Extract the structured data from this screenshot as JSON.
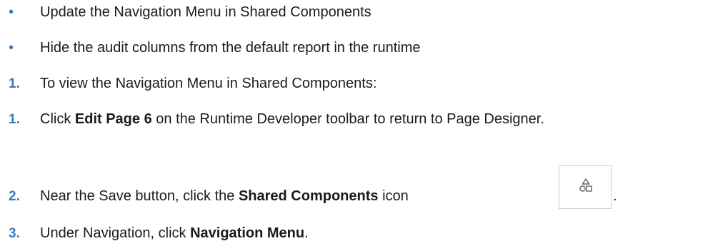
{
  "bullets": [
    "Update the Navigation Menu in Shared Components",
    "Hide the audit columns from the default report in the runtime"
  ],
  "intro": {
    "marker": "1.",
    "text": "To view the Navigation Menu in Shared Components:"
  },
  "steps": [
    {
      "marker": "1.",
      "pre": "Click ",
      "bold": "Edit Page 6",
      "post": " on the Runtime Developer toolbar to return to Page Designer."
    },
    {
      "marker": "2.",
      "pre": "Near the Save button, click the ",
      "bold": "Shared Components",
      "post": " icon",
      "trailing": "."
    },
    {
      "marker": "3.",
      "pre": "Under Navigation, click ",
      "bold": "Navigation Menu",
      "post": "."
    }
  ],
  "colors": {
    "marker": "#3a7bbf",
    "text": "#1a1a1a",
    "icon_border": "#cfcfcf",
    "icon_stroke": "#4a4a4a"
  },
  "icon": "shared-components-icon"
}
